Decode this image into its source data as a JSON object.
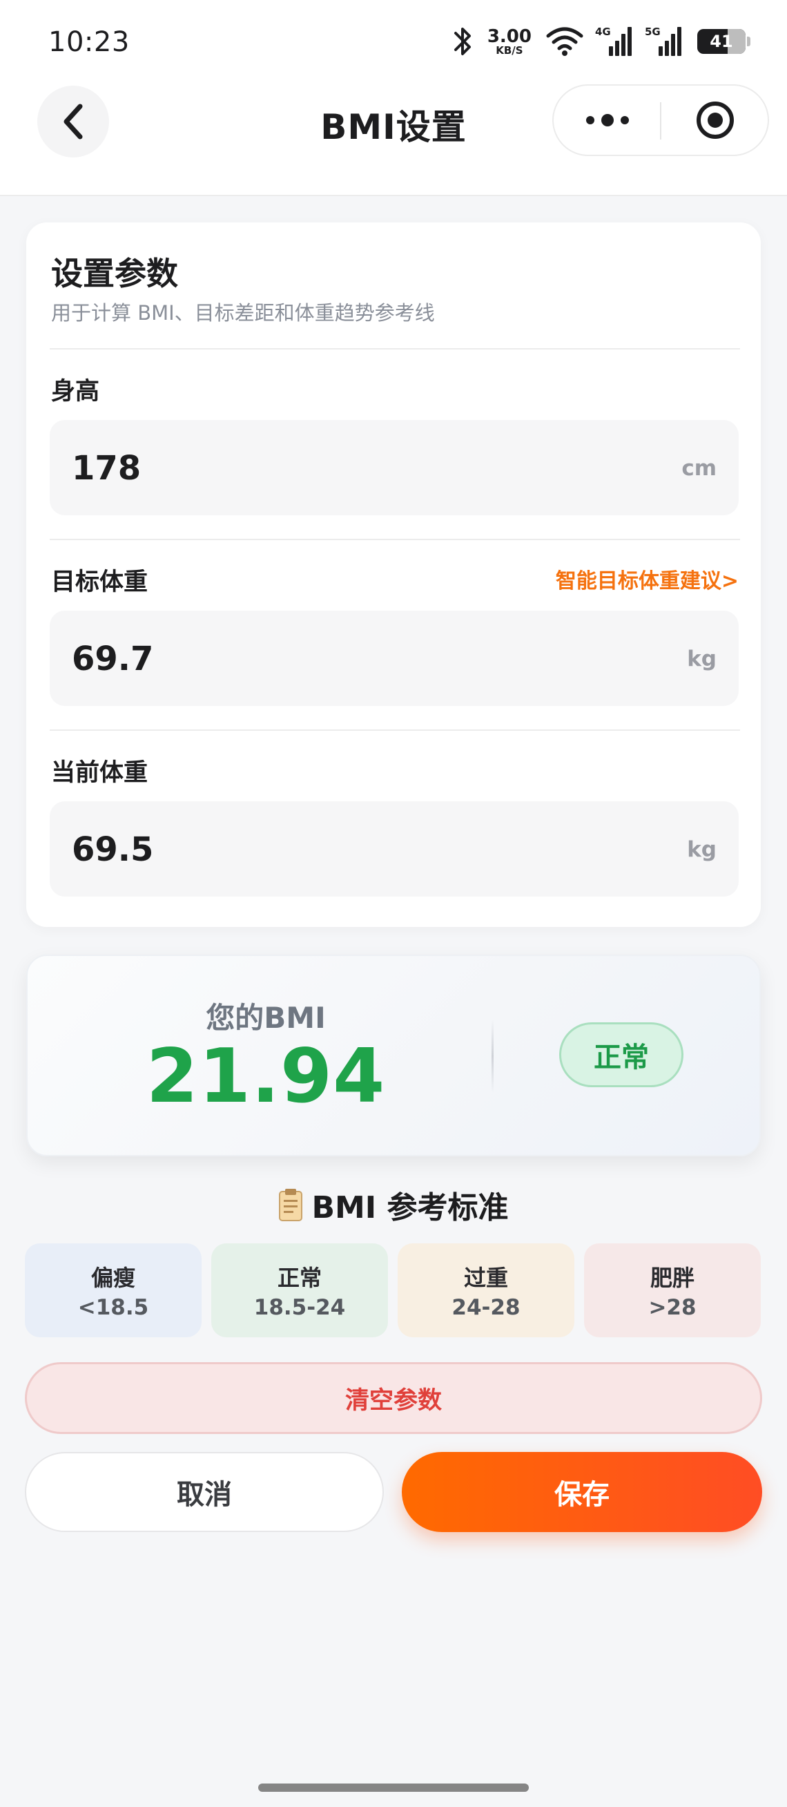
{
  "status_bar": {
    "time": "10:23",
    "net_speed_value": "3.00",
    "net_speed_unit": "KB/S",
    "signal1_tag": "4G",
    "signal2_tag": "5G",
    "battery": "41"
  },
  "nav": {
    "title": "BMI设置"
  },
  "settings": {
    "title": "设置参数",
    "subtitle": "用于计算 BMI、目标差距和体重趋势参考线",
    "height": {
      "label": "身高",
      "value": "178",
      "unit": "cm"
    },
    "target_weight": {
      "label": "目标体重",
      "link": "智能目标体重建议>",
      "value": "69.7",
      "unit": "kg"
    },
    "current_weight": {
      "label": "当前体重",
      "value": "69.5",
      "unit": "kg"
    }
  },
  "bmi": {
    "label": "您的BMI",
    "value": "21.94",
    "status": "正常",
    "status_color": "#1c9a48"
  },
  "reference": {
    "title": "BMI 参考标准",
    "items": [
      {
        "name": "偏瘦",
        "range": "<18.5",
        "color": "#e8eef8"
      },
      {
        "name": "正常",
        "range": "18.5-24",
        "color": "#e5f1e9"
      },
      {
        "name": "过重",
        "range": "24-28",
        "color": "#f8efe2"
      },
      {
        "name": "肥胖",
        "range": ">28",
        "color": "#f6e8e8"
      }
    ]
  },
  "actions": {
    "clear": "清空参数",
    "cancel": "取消",
    "save": "保存"
  },
  "colors": {
    "accent": "#ff6a00",
    "link": "#f5720f",
    "bmi_green": "#1fa34a",
    "danger": "#e0403a"
  }
}
